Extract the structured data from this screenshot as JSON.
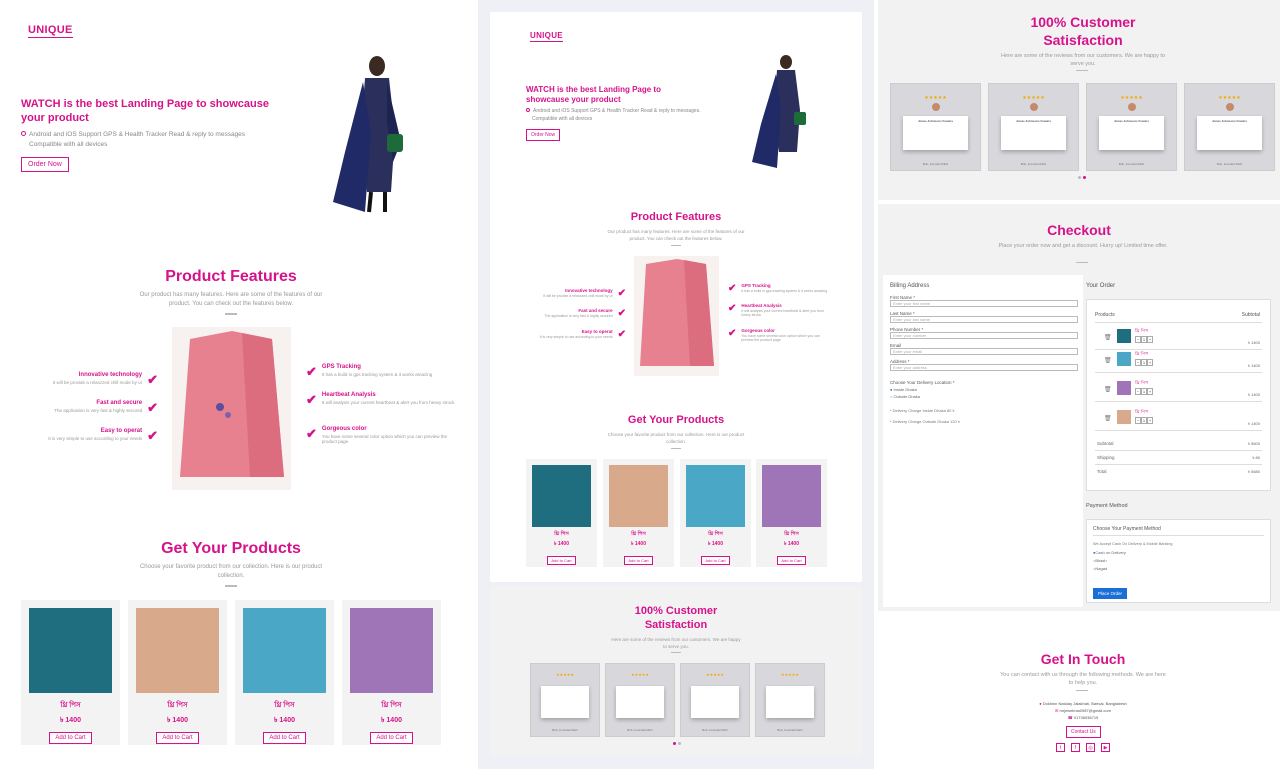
{
  "colors": {
    "accent": "#d6128a",
    "star": "#f0a800"
  },
  "logo": "UNIQUE",
  "hero": {
    "title": "WATCH is the best Landing Page to showcause your product",
    "desc_1": "Android and iOS Support GPS & Health Tracker Read & reply to messages",
    "desc_2": "Compatible with all devices",
    "button": "Order Now"
  },
  "hero2": {
    "title": "WATCH is the best Landing Page to showcause your product",
    "desc_1": "Android and iOS Support GPS & Health Tracker Read & reply to messages.",
    "desc_2": "Compatible with all devices",
    "button": "Order Now"
  },
  "features": {
    "title": "Product Features",
    "subtitle": "Our product has many features. Here are some of the features of our product. You can check out the features below.",
    "left": [
      {
        "title": "Innovative technology",
        "desc": "It will be provide a relaxzzed chill mode by ur"
      },
      {
        "title": "Fast and secure",
        "desc": "The application is very fast & highly secured"
      },
      {
        "title": "Easy to operat",
        "desc": "It is very simple to use according to your needs"
      }
    ],
    "right": [
      {
        "title": "GPS Tracking",
        "desc": "It has a build in gps tracking system & it works amazing"
      },
      {
        "title": "Heartbeat Analysis",
        "desc": "It will analysis your current heartbeat & alert you from heavy strock"
      },
      {
        "title": "Gorgeous color",
        "desc": "You have some several color option which you can preview the product page"
      }
    ],
    "check": "✔"
  },
  "products": {
    "title": "Get Your Products",
    "subtitle": "Choose your favorite product from our collection. Here is our product collection.",
    "items": [
      {
        "name": "থ্রি পিস",
        "price": "৳ 1400",
        "button": "Add to Cart",
        "color": "#1f6e80"
      },
      {
        "name": "থ্রি পিস",
        "price": "৳ 1400",
        "button": "Add to Cart",
        "color": "#d9a98b"
      },
      {
        "name": "থ্রি পিস",
        "price": "৳ 1400",
        "button": "Add to Cart",
        "color": "#4ba7c6"
      },
      {
        "name": "থ্রি পিস",
        "price": "৳ 1400",
        "button": "Add to Cart",
        "color": "#9f75b8"
      }
    ]
  },
  "satisfaction": {
    "title": "100% Customer Satisfaction",
    "subtitle": "Here are some of the reviews from our customers. We are happy to serve you.",
    "stars": "★★★★★",
    "reviewer": "Jonas Johnsons Fowars",
    "caption": "Bob, Founder/CEO"
  },
  "checkout": {
    "title": "Checkout",
    "subtitle": "Place your order now and get a discount. Hurry up! Limited time offer.",
    "billing_title": "Billing Address",
    "fields": [
      {
        "label": "First Name *",
        "placeholder": "Enter your first name"
      },
      {
        "label": "Last Name *",
        "placeholder": "Enter your last name"
      },
      {
        "label": "Phone Number *",
        "placeholder": "Enter your number"
      },
      {
        "label": "Email",
        "placeholder": "Enter your email"
      },
      {
        "label": "Address *",
        "placeholder": "Enter your address"
      }
    ],
    "delivery_label": "Choose Your Delivery Location *",
    "delivery_opts": [
      "Inside Dhaka",
      "Outside Dhaka"
    ],
    "charge_inside": "* Delivery Charge Inside Dhaka 80 ৳",
    "charge_outside": "* Delivery Charge Outside Dhaka 120 ৳",
    "order_title": "Your Order",
    "col_products": "Products",
    "col_subtotal": "Subtotal",
    "order_items": [
      {
        "name": "থ্রি পিস",
        "qty": "1",
        "price": "৳ 1400",
        "color": "#1f6e80"
      },
      {
        "name": "থ্রি পিস",
        "qty": "1",
        "price": "৳ 1400",
        "color": "#4ba7c6"
      },
      {
        "name": "থ্রি পিস",
        "qty": "1",
        "price": "৳ 1400",
        "color": "#9f75b8"
      },
      {
        "name": "থ্রি পিস",
        "qty": "1",
        "price": "৳ 1400",
        "color": "#d9a98b"
      }
    ],
    "subtotal_label": "Subtotal",
    "subtotal_value": "৳ 5600",
    "shipping_label": "Shipping",
    "shipping_value": "৳ 80",
    "total_label": "Total",
    "total_value": "৳ 5680",
    "payment_title": "Payment Method",
    "payment_box_title": "Choose Your Payment Method",
    "payment_note": "We Accept Cash On Delivery & Mobile Banking",
    "payment_opts": [
      "Cash on Delivery",
      "Bkash",
      "Nagad"
    ],
    "place_order": "Place Order"
  },
  "contact": {
    "title": "Get In Touch",
    "subtitle": "You can contact with us through the following methods. We are here to help you.",
    "address": "Dokhinn Natulay Jalakhati, Barisal, Bangladesh",
    "email": "mrjewelmia0987@gmail.com",
    "phone": "01736938719",
    "button": "Contact Us",
    "social_icons": [
      "twitter-icon",
      "facebook-icon",
      "instagram-icon",
      "youtube-icon"
    ]
  }
}
